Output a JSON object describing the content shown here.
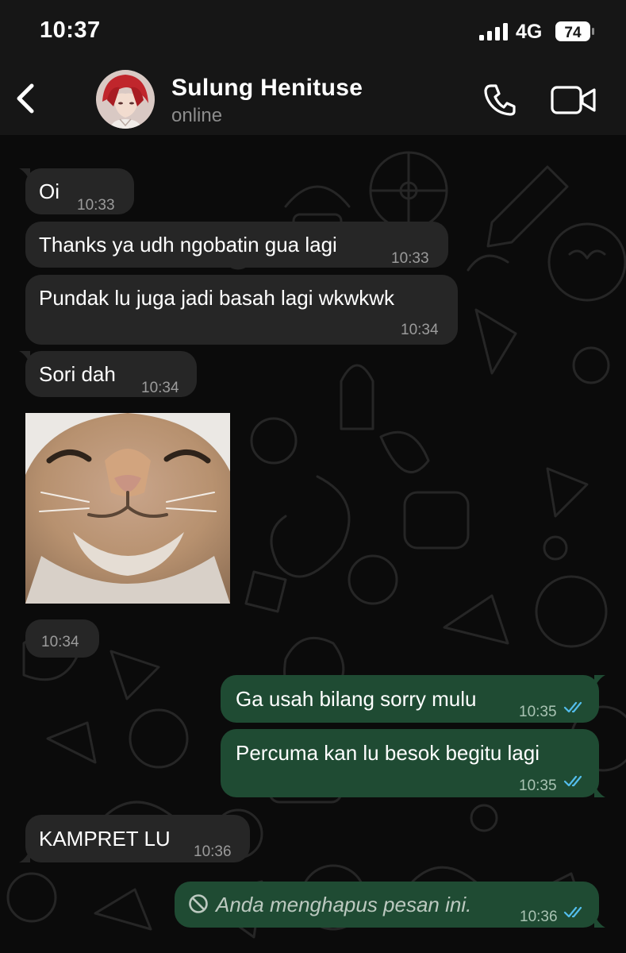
{
  "status_bar": {
    "time": "10:37",
    "network": "4G",
    "battery": "74"
  },
  "header": {
    "contact_name": "Sulung Henituse",
    "contact_status": "online"
  },
  "messages": [
    {
      "direction": "in",
      "text": "Oi",
      "time": "10:33"
    },
    {
      "direction": "in",
      "text": "Thanks ya udh ngobatin gua lagi",
      "time": "10:33"
    },
    {
      "direction": "in",
      "text": "Pundak lu juga jadi basah lagi wkwkwk",
      "time": "10:34"
    },
    {
      "direction": "in",
      "text": "Sori dah",
      "time": "10:34"
    },
    {
      "direction": "in",
      "type": "image",
      "time": "10:34"
    },
    {
      "direction": "out",
      "text": "Ga usah bilang sorry mulu",
      "time": "10:35",
      "status": "read"
    },
    {
      "direction": "out",
      "text": "Percuma kan lu besok begitu lagi",
      "time": "10:35",
      "status": "read"
    },
    {
      "direction": "in",
      "text": "KAMPRET LU",
      "time": "10:36"
    },
    {
      "direction": "out",
      "text": "Anda menghapus pesan ini.",
      "time": "10:36",
      "status": "read",
      "deleted": true
    }
  ],
  "colors": {
    "incoming_bubble": "#262626",
    "outgoing_bubble": "#1f4b33",
    "read_ticks": "#53bdeb",
    "background": "#0b0b0b"
  },
  "icons": [
    "back-chevron-icon",
    "phone-icon",
    "video-camera-icon",
    "signal-icon",
    "battery-icon",
    "double-check-icon",
    "ban-icon"
  ]
}
